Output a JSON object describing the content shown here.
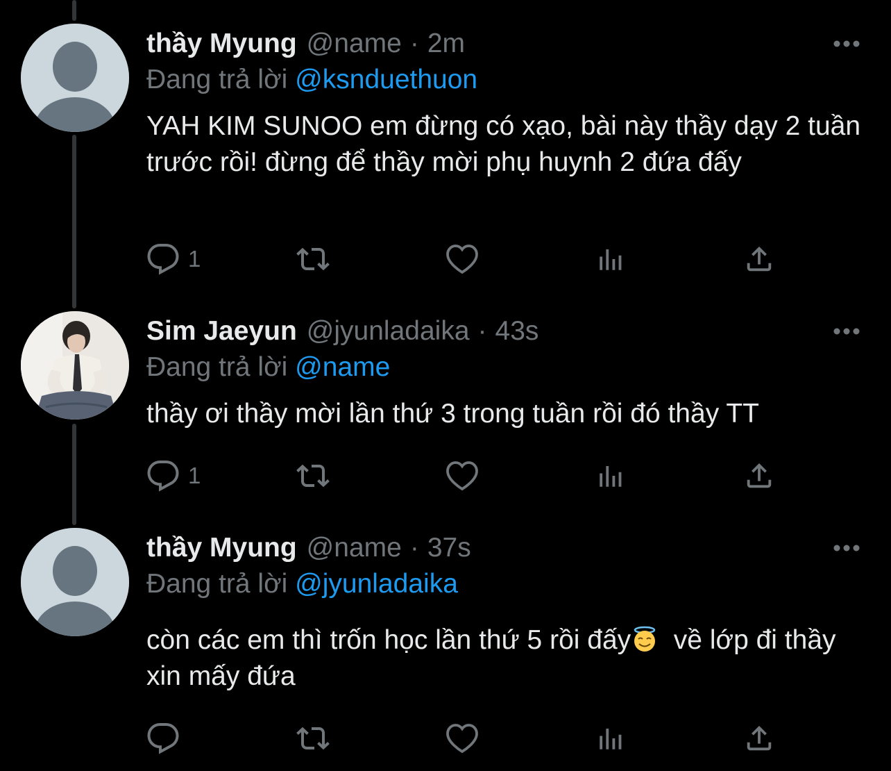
{
  "colors": {
    "background": "#000000",
    "primary_text": "#e7e9ea",
    "secondary_text": "#71767b",
    "link": "#1d9bf0",
    "thread_line": "#333639"
  },
  "tweets": [
    {
      "display_name": "thầy Myung",
      "handle": "@name",
      "separator": "·",
      "time": "2m",
      "reply_label": "Đang trả lời",
      "reply_to": "@ksnduethuon",
      "text": "YAH KIM SUNOO em đừng có xạo, bài này thầy dạy 2 tuần trước rồi! đừng để thầy mời phụ huynh 2 đứa đấy",
      "reply_count": "1",
      "avatar": "default-avatar"
    },
    {
      "display_name": "Sim Jaeyun",
      "handle": "@jyunladaika",
      "separator": "·",
      "time": "43s",
      "reply_label": "Đang trả lời",
      "reply_to": "@name",
      "text": "thầy ơi thầy mời lần thứ 3 trong tuần rồi đó thầy TT",
      "reply_count": "1",
      "avatar": "profile-photo"
    },
    {
      "display_name": "thầy Myung",
      "handle": "@name",
      "separator": "·",
      "time": "37s",
      "reply_label": "Đang trả lời",
      "reply_to": "@jyunladaika",
      "text_before_emoji": "còn các em thì trốn học lần thứ 5 rồi đấy",
      "emoji": "smiling-face-with-halo",
      "text_after_emoji": "  về lớp đi thầy xin mấy đứa",
      "reply_count": "",
      "avatar": "default-avatar"
    }
  ],
  "icons": {
    "reply": "reply-icon",
    "retweet": "retweet-icon",
    "like": "heart-icon",
    "views": "views-chart-icon",
    "share": "share-icon",
    "more": "more-options-icon"
  }
}
